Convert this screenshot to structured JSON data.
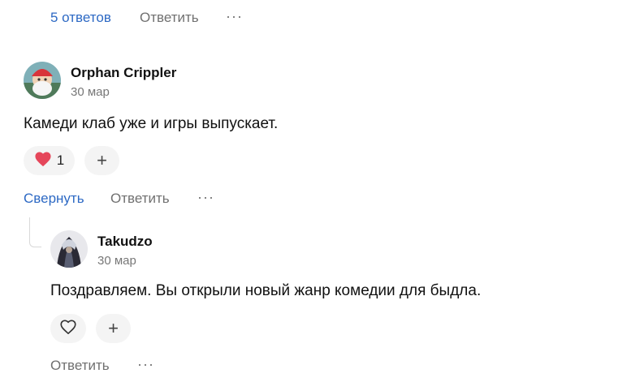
{
  "top_actions": {
    "replies_link": "5 ответов",
    "reply": "Ответить",
    "more": "···"
  },
  "comment": {
    "author": "Orphan Crippler",
    "date": "30 мар",
    "text": "Камеди клаб уже и игры выпускает.",
    "likes": "1",
    "add_reaction": "+",
    "collapse": "Свернуть",
    "reply": "Ответить",
    "more": "···"
  },
  "reply_comment": {
    "author": "Takudzo",
    "date": "30 мар",
    "text": "Поздравляем. Вы открыли новый жанр комедии для быдла.",
    "add_reaction": "+",
    "reply": "Ответить",
    "more": "···"
  },
  "colors": {
    "link": "#2d69c4",
    "heart": "#e5465a",
    "pill_bg": "#f4f4f4"
  }
}
